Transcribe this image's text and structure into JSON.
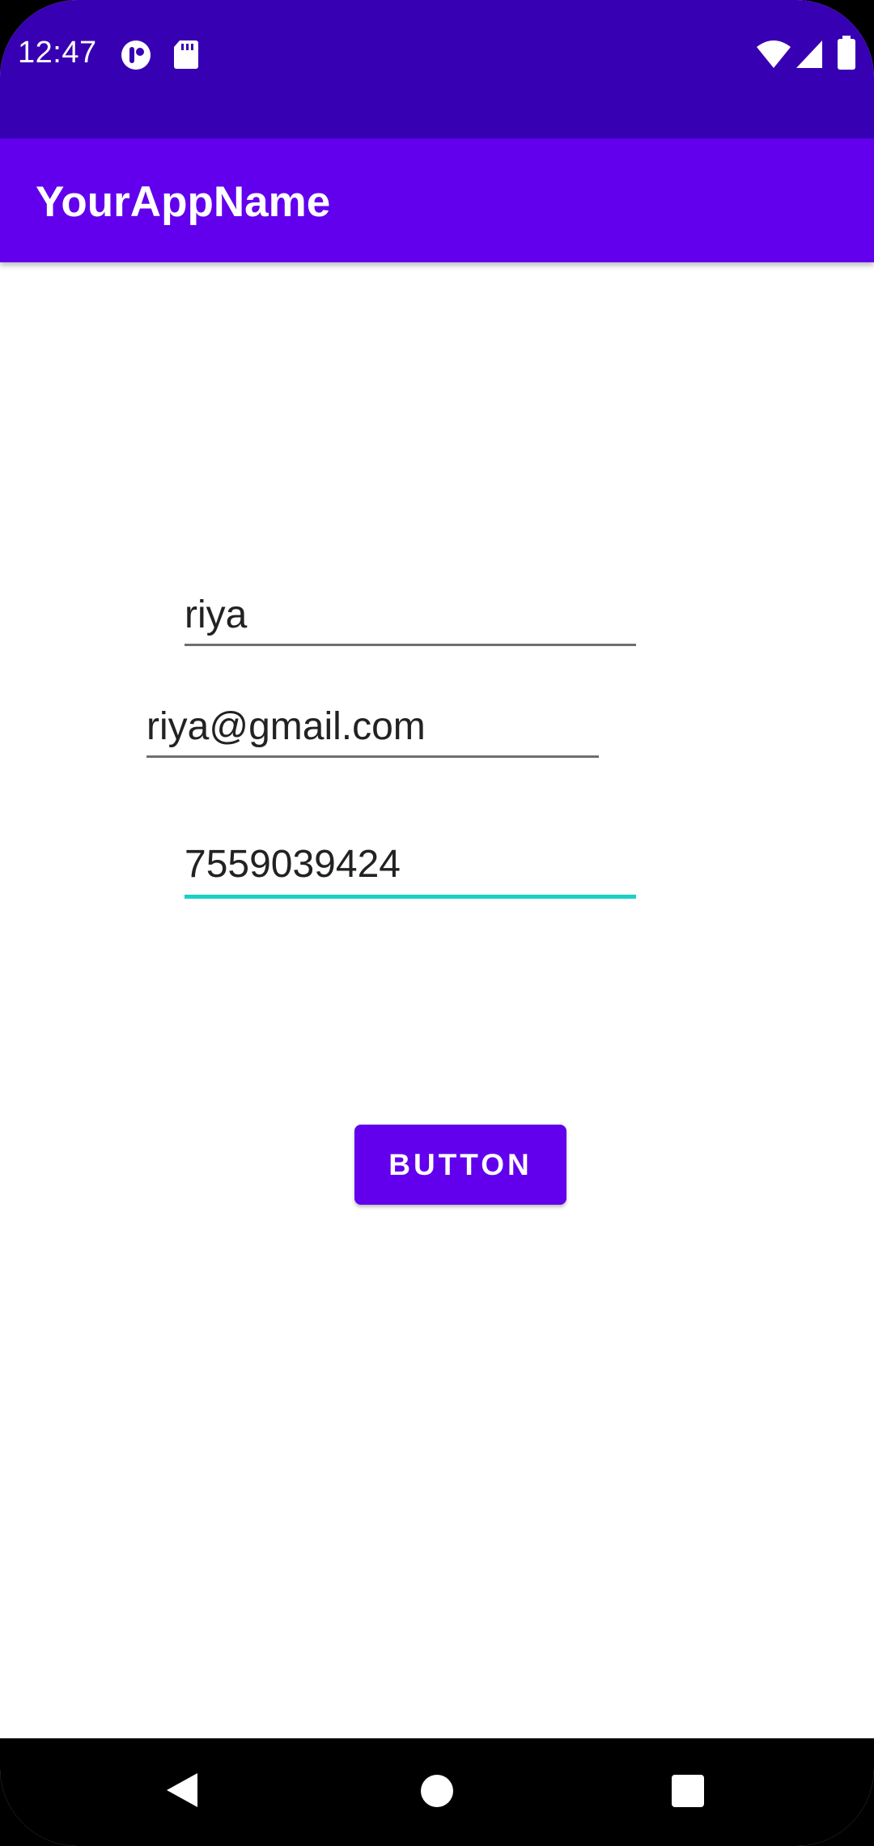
{
  "status_bar": {
    "time": "12:47",
    "left_icons": [
      "app-notification-icon",
      "sd-card-icon"
    ],
    "right_icons": [
      "wifi-icon",
      "signal-icon",
      "battery-icon"
    ],
    "color": "#3700b3"
  },
  "app_bar": {
    "title": "YourAppName",
    "color": "#6200ee"
  },
  "form": {
    "name_value": "riya",
    "email_value": "riya@gmail.com",
    "phone_value": "7559039424",
    "focused_accent": "#1ad0c8"
  },
  "button": {
    "label": "BUTTON",
    "color": "#6200ee"
  },
  "nav_bar": {
    "icons": [
      "back-icon",
      "home-icon",
      "recents-icon"
    ]
  }
}
